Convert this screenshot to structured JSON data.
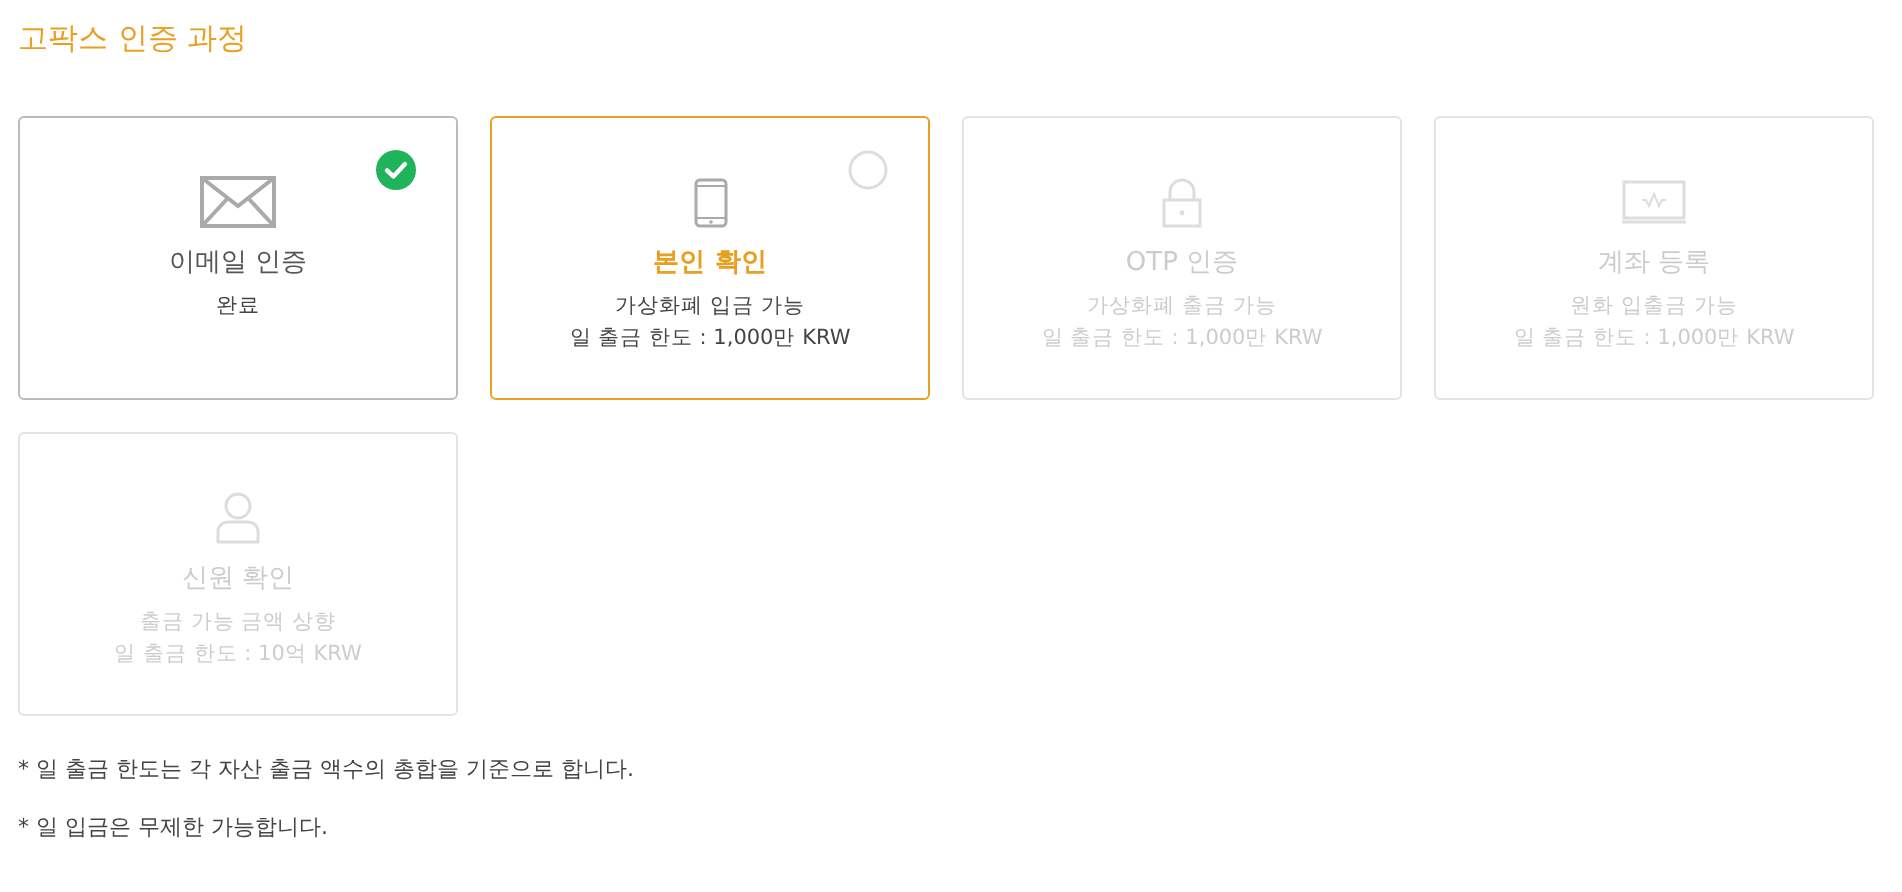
{
  "title": "고팍스 인증 과정",
  "steps": [
    {
      "kind": "mail",
      "completed": true,
      "selected": false,
      "disabled": false,
      "name": "이메일 인증",
      "lines": [
        "완료"
      ]
    },
    {
      "kind": "phone",
      "completed": false,
      "selected": true,
      "disabled": false,
      "name": "본인 확인",
      "lines": [
        "가상화폐 입금 가능",
        "일 출금 한도 : 1,000만 KRW"
      ]
    },
    {
      "kind": "lock",
      "completed": false,
      "selected": false,
      "disabled": true,
      "name": "OTP 인증",
      "lines": [
        "가상화폐 출금 가능",
        "일 출금 한도 : 1,000만 KRW"
      ]
    },
    {
      "kind": "account",
      "completed": false,
      "selected": false,
      "disabled": true,
      "name": "계좌 등록",
      "lines": [
        "원화 입출금 가능",
        "일 출금 한도 : 1,000만 KRW"
      ]
    },
    {
      "kind": "person",
      "completed": false,
      "selected": false,
      "disabled": true,
      "name": "신원 확인",
      "lines": [
        "출금 가능 금액 상향",
        "일 출금 한도 : 10억 KRW"
      ]
    }
  ],
  "notes": [
    "* 일 출금 한도는 각 자산 출금 액수의 총합을 기준으로 합니다.",
    "* 일 입금은 무제한 가능합니다."
  ]
}
